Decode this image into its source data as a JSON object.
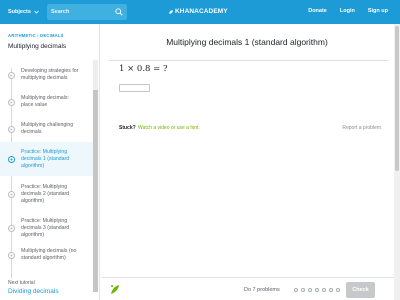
{
  "header": {
    "subjects": "Subjects",
    "search_placeholder": "Search",
    "logo": "KHANACADEMY",
    "nav": [
      "Donate",
      "Login",
      "Sign up"
    ]
  },
  "sidebar": {
    "breadcrumb": "ARITHMETIC › DECIMALS",
    "tutorial_title": "Multiplying decimals",
    "items": [
      {
        "label": "Developing strategies for multiplying decimals",
        "icon": "play-icon"
      },
      {
        "label": "Multiplying decimals: place value",
        "icon": "play-icon"
      },
      {
        "label": "Multiplying challenging decimals",
        "icon": "play-icon"
      },
      {
        "label": "Practice: Multiplying decimals 1 (standard algorithm)",
        "icon": "exercise-icon"
      },
      {
        "label": "Practice: Multiplying decimals 2 (standard algorithm)",
        "icon": "exercise-icon"
      },
      {
        "label": "Practice: Multiplying decimals 3 (standard algorithm)",
        "icon": "exercise-icon"
      },
      {
        "label": "Multiplying decimals (no standard algorithm)",
        "icon": "exercise-icon"
      }
    ],
    "next_label": "Next tutorial",
    "next_link": "Dividing decimals"
  },
  "main": {
    "title": "Multiplying decimals 1 (standard algorithm)",
    "problem": "1 × 0.8 = ?",
    "answer_value": "",
    "stuck": "Stuck?",
    "hint_link": "Watch a video or use a hint.",
    "report": "Report a problem"
  },
  "footer": {
    "do_n": "Do 7 problems",
    "progress_total": 7,
    "progress_done": 0,
    "check": "Check"
  },
  "colors": {
    "brand": "#1c9bd6",
    "hint": "#71b307",
    "check_disabled": "#c6c8cc"
  }
}
